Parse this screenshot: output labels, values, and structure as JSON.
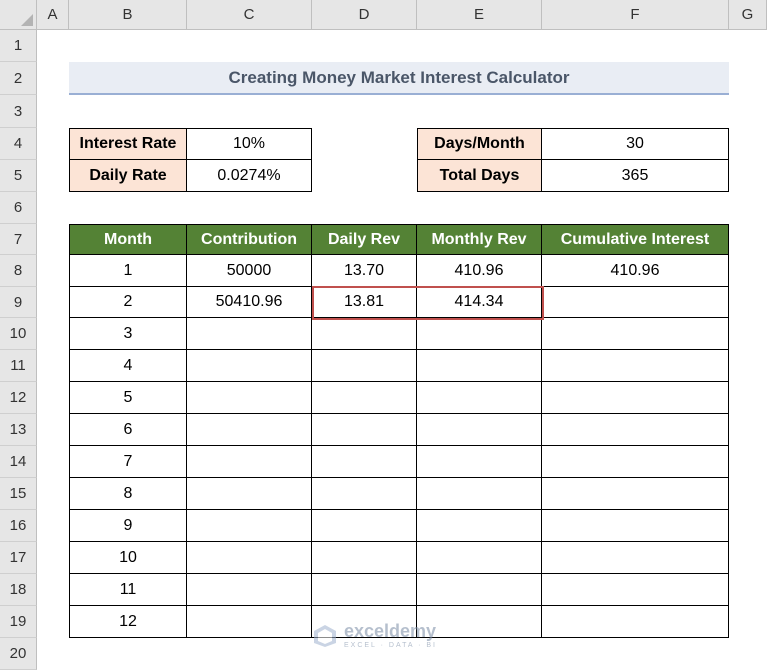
{
  "columns": [
    "A",
    "B",
    "C",
    "D",
    "E",
    "F",
    "G"
  ],
  "rows": [
    "1",
    "2",
    "3",
    "4",
    "5",
    "6",
    "7",
    "8",
    "9",
    "10",
    "11",
    "12",
    "13",
    "14",
    "15",
    "16",
    "17",
    "18",
    "19",
    "20"
  ],
  "title": "Creating Money Market Interest Calculator",
  "params_left": [
    {
      "label": "Interest Rate",
      "value": "10%"
    },
    {
      "label": "Daily Rate",
      "value": "0.0274%"
    }
  ],
  "params_right": [
    {
      "label": "Days/Month",
      "value": "30"
    },
    {
      "label": "Total Days",
      "value": "365"
    }
  ],
  "table": {
    "headers": [
      "Month",
      "Contribution",
      "Daily Rev",
      "Monthly Rev",
      "Cumulative Interest"
    ],
    "rows": [
      [
        "1",
        "50000",
        "13.70",
        "410.96",
        "410.96"
      ],
      [
        "2",
        "50410.96",
        "13.81",
        "414.34",
        ""
      ],
      [
        "3",
        "",
        "",
        "",
        ""
      ],
      [
        "4",
        "",
        "",
        "",
        ""
      ],
      [
        "5",
        "",
        "",
        "",
        ""
      ],
      [
        "6",
        "",
        "",
        "",
        ""
      ],
      [
        "7",
        "",
        "",
        "",
        ""
      ],
      [
        "8",
        "",
        "",
        "",
        ""
      ],
      [
        "9",
        "",
        "",
        "",
        ""
      ],
      [
        "10",
        "",
        "",
        "",
        ""
      ],
      [
        "11",
        "",
        "",
        "",
        ""
      ],
      [
        "12",
        "",
        "",
        "",
        ""
      ]
    ]
  },
  "watermark": {
    "name": "exceldemy",
    "sub": "EXCEL · DATA · BI"
  },
  "colors": {
    "header_green": "#548235",
    "label_peach": "#fce4d6",
    "title_bg": "#e9edf4",
    "highlight": "#c0504d"
  }
}
